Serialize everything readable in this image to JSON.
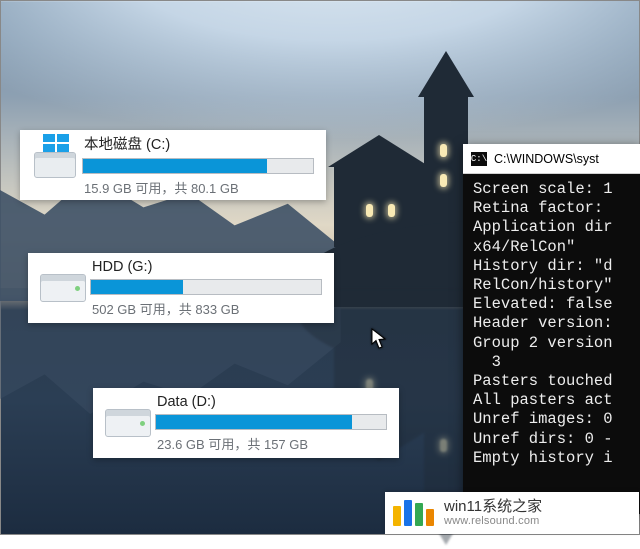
{
  "drives": [
    {
      "label": "本地磁盘 (C:)",
      "free": "15.9 GB",
      "total": "80.1 GB",
      "used_pct": 80
    },
    {
      "label": "HDD (G:)",
      "free": "502 GB",
      "total": "833 GB",
      "used_pct": 40
    },
    {
      "label": "Data (D:)",
      "free": "23.6 GB",
      "total": "157 GB",
      "used_pct": 85
    }
  ],
  "sub_template": {
    "free_word": "可用",
    "sep": "，共 "
  },
  "console": {
    "title": "C:\\WINDOWS\\syst",
    "lines": [
      "Screen scale: 1",
      "Retina factor:",
      "Application dir",
      "x64/RelCon\"",
      "History dir: \"d",
      "RelCon/history\"",
      "Elevated: false",
      "Header version:",
      "Group 2 version",
      "  3",
      "Pasters touched",
      "All pasters act",
      "Unref images: 0",
      "Unref dirs: 0 -",
      "Empty history i"
    ]
  },
  "brand": {
    "name": "win11系统之家",
    "url": "www.relsound.com"
  }
}
